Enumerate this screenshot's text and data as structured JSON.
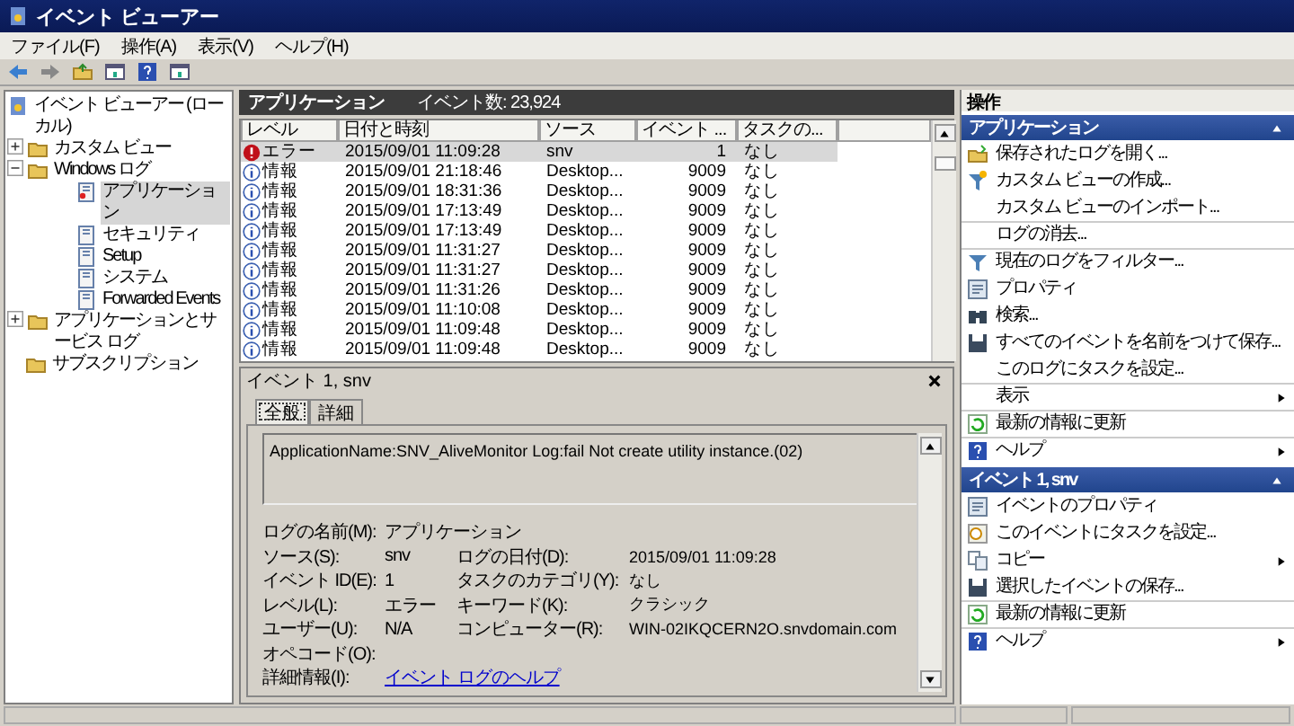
{
  "window": {
    "title": "イベント ビューアー"
  },
  "menu": [
    "ファイル(F)",
    "操作(A)",
    "表示(V)",
    "ヘルプ(H)"
  ],
  "tree": [
    {
      "label": "イベント ビューアー (ローカル)",
      "selected": false,
      "children": [
        {
          "label": "カスタム ビュー",
          "selected": false,
          "expanded": false
        },
        {
          "label": "Windows ログ",
          "selected": false,
          "expanded": true,
          "children": [
            {
              "label": "アプリケーション",
              "selected": true
            },
            {
              "label": "セキュリティ",
              "selected": false
            },
            {
              "label": "Setup",
              "selected": false
            },
            {
              "label": "システム",
              "selected": false
            },
            {
              "label": "Forwarded Events",
              "selected": false
            }
          ]
        },
        {
          "label": "アプリケーションとサービス ログ",
          "selected": false,
          "expanded": false
        },
        {
          "label": "サブスクリプション",
          "selected": false
        }
      ]
    }
  ],
  "log_header": {
    "title": "アプリケーション",
    "count": "イベント数: 23,924"
  },
  "table": {
    "columns": [
      "レベル",
      "日付と時刻",
      "ソース",
      "イベント ...",
      "タスクの..."
    ],
    "rows": [
      {
        "kind": "error",
        "selected": true,
        "cells": [
          "エラー",
          "2015/09/01 11:09:28",
          "snv",
          "1",
          "なし"
        ]
      },
      {
        "kind": "info",
        "selected": false,
        "cells": [
          "情報",
          "2015/09/01 21:18:46",
          "Desktop...",
          "9009",
          "なし"
        ]
      },
      {
        "kind": "info",
        "selected": false,
        "cells": [
          "情報",
          "2015/09/01 18:31:36",
          "Desktop...",
          "9009",
          "なし"
        ]
      },
      {
        "kind": "info",
        "selected": false,
        "cells": [
          "情報",
          "2015/09/01 17:13:49",
          "Desktop...",
          "9009",
          "なし"
        ]
      },
      {
        "kind": "info",
        "selected": false,
        "cells": [
          "情報",
          "2015/09/01 17:13:49",
          "Desktop...",
          "9009",
          "なし"
        ]
      },
      {
        "kind": "info",
        "selected": false,
        "cells": [
          "情報",
          "2015/09/01 11:31:27",
          "Desktop...",
          "9009",
          "なし"
        ]
      },
      {
        "kind": "info",
        "selected": false,
        "cells": [
          "情報",
          "2015/09/01 11:31:27",
          "Desktop...",
          "9009",
          "なし"
        ]
      },
      {
        "kind": "info",
        "selected": false,
        "cells": [
          "情報",
          "2015/09/01 11:31:26",
          "Desktop...",
          "9009",
          "なし"
        ]
      },
      {
        "kind": "info",
        "selected": false,
        "cells": [
          "情報",
          "2015/09/01 11:10:08",
          "Desktop...",
          "9009",
          "なし"
        ]
      },
      {
        "kind": "info",
        "selected": false,
        "cells": [
          "情報",
          "2015/09/01 11:09:48",
          "Desktop...",
          "9009",
          "なし"
        ]
      },
      {
        "kind": "info",
        "selected": false,
        "cells": [
          "情報",
          "2015/09/01 11:09:48",
          "Desktop...",
          "9009",
          "なし"
        ]
      }
    ]
  },
  "detail": {
    "title": "イベント 1, snv",
    "tabs": [
      {
        "label": "全般",
        "selected": true
      },
      {
        "label": "詳細",
        "selected": false
      }
    ],
    "message": "ApplicationName:SNV_AliveMonitor Log:fail    Not create utility instance.(02)",
    "rows": [
      {
        "left": {
          "label": "ログの名前(M):",
          "value": "アプリケーション"
        }
      },
      {
        "left": {
          "label": "ソース(S):",
          "value": "snv"
        },
        "right": {
          "label": "ログの日付(D):",
          "value": "2015/09/01 11:09:28"
        }
      },
      {
        "left": {
          "label": "イベント ID(E):",
          "value": "1"
        },
        "right": {
          "label": "タスクのカテゴリ(Y):",
          "value": "なし"
        }
      },
      {
        "left": {
          "label": "レベル(L):",
          "value": "エラー"
        },
        "right": {
          "label": "キーワード(K):",
          "value": "クラシック"
        }
      },
      {
        "left": {
          "label": "ユーザー(U):",
          "value": "N/A"
        },
        "right": {
          "label": "コンピューター(R):",
          "value": "WIN-02IKQCERN2O.snvdomain.com"
        }
      },
      {
        "left": {
          "label": "オペコード(O):"
        }
      },
      {
        "left": {
          "label": "詳細情報(I):",
          "value": "イベント ログのヘルプ",
          "link": true
        }
      }
    ]
  },
  "actions": {
    "title": "操作",
    "sections": [
      {
        "title": "アプリケーション",
        "expanded": true,
        "items": [
          {
            "label": "保存されたログを開く...",
            "separator_above": false,
            "submenu": false
          },
          {
            "label": "カスタム ビューの作成...",
            "separator_above": false,
            "submenu": false
          },
          {
            "label": "カスタム ビューのインポート...",
            "separator_above": false,
            "submenu": false
          },
          {
            "label": "ログの消去...",
            "separator_above": true,
            "submenu": false
          },
          {
            "label": "現在のログをフィルター...",
            "separator_above": true,
            "submenu": false
          },
          {
            "label": "プロパティ",
            "separator_above": false,
            "submenu": false
          },
          {
            "label": "検索...",
            "separator_above": false,
            "submenu": false
          },
          {
            "label": "すべてのイベントを名前をつけて保存...",
            "separator_above": false,
            "submenu": false
          },
          {
            "label": "このログにタスクを設定...",
            "separator_above": false,
            "submenu": false
          },
          {
            "label": "表示",
            "separator_above": true,
            "submenu": true
          },
          {
            "label": "最新の情報に更新",
            "separator_above": true,
            "submenu": false
          },
          {
            "label": "ヘルプ",
            "separator_above": true,
            "submenu": true
          }
        ]
      },
      {
        "title": "イベント 1, snv",
        "expanded": true,
        "items": [
          {
            "label": "イベントのプロパティ",
            "separator_above": false,
            "submenu": false
          },
          {
            "label": "このイベントにタスクを設定...",
            "separator_above": false,
            "submenu": false
          },
          {
            "label": "コピー",
            "separator_above": false,
            "submenu": true
          },
          {
            "label": "選択したイベントの保存...",
            "separator_above": false,
            "submenu": false
          },
          {
            "label": "最新の情報に更新",
            "separator_above": true,
            "submenu": false
          },
          {
            "label": "ヘルプ",
            "separator_above": true,
            "submenu": true
          }
        ]
      }
    ]
  }
}
